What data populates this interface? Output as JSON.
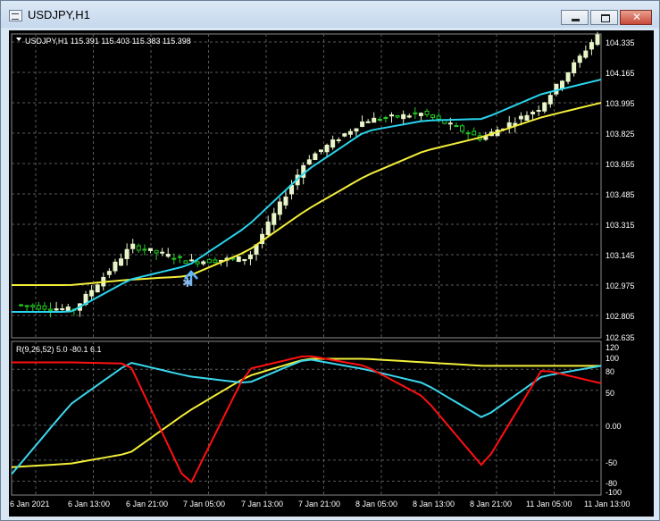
{
  "window": {
    "title": "USDJPY,H1",
    "buttons": {
      "minimize": "minimize",
      "maximize": "maximize",
      "close": "✕"
    }
  },
  "main_chart": {
    "header": "USDJPY,H1  115.391 115.403 115.383 115.398",
    "price_axis": [
      "104.335",
      "104.165",
      "103.995",
      "103.825",
      "103.655",
      "103.485",
      "103.315",
      "103.145",
      "102.975",
      "102.805",
      "102.635"
    ]
  },
  "indicator": {
    "header": "R(9,26,52) 5.0 -80.1 6.1",
    "axis": [
      "120",
      "100",
      "80",
      "50",
      "0.00",
      "-50",
      "-80",
      "-100"
    ]
  },
  "time_axis": [
    "6 Jan 2021",
    "6 Jan 13:00",
    "6 Jan 21:00",
    "7 Jan 05:00",
    "7 Jan 13:00",
    "7 Jan 21:00",
    "8 Jan 05:00",
    "8 Jan 13:00",
    "8 Jan 21:00",
    "11 Jan 05:00",
    "11 Jan 13:00"
  ],
  "colors": {
    "background": "#000000",
    "grid": "#5a5a5a",
    "bull_candle": "#e8f5c8",
    "bear_candle": "#22cc22",
    "ma_fast": "#29d5ee",
    "ma_slow": "#f2ee3a",
    "osc_red": "#ff1010",
    "osc_cyan": "#3ad7ee",
    "osc_yellow": "#f2ee3a",
    "signal_arrow": "#5fb8ff"
  },
  "chart_data": {
    "type": "line",
    "title": "USDJPY,H1",
    "y_range": [
      102.635,
      104.335
    ],
    "x": [
      "6 Jan 2021",
      "6 Jan 13:00",
      "6 Jan 21:00",
      "7 Jan 05:00",
      "7 Jan 13:00",
      "7 Jan 21:00",
      "8 Jan 05:00",
      "8 Jan 13:00",
      "8 Jan 21:00",
      "11 Jan 05:00",
      "11 Jan 13:00"
    ],
    "series": [
      {
        "values": [
          102.82,
          102.79,
          103.15,
          103.06,
          103.08,
          103.63,
          103.85,
          103.89,
          103.75,
          103.92,
          104.33
        ]
      },
      {
        "values": [
          102.78,
          102.78,
          102.96,
          103.04,
          103.26,
          103.57,
          103.79,
          103.85,
          103.86,
          104.0,
          104.08
        ]
      },
      {
        "values": [
          102.93,
          102.93,
          102.96,
          102.98,
          103.12,
          103.35,
          103.54,
          103.68,
          103.76,
          103.87,
          103.95
        ]
      }
    ],
    "indicator": {
      "y_range": [
        -100,
        120
      ],
      "series": [
        {
          "values": [
            90,
            90,
            88,
            -90,
            80,
            100,
            85,
            40,
            -60,
            80,
            60
          ]
        },
        {
          "values": [
            -70,
            30,
            90,
            70,
            60,
            95,
            80,
            60,
            10,
            70,
            85
          ]
        },
        {
          "values": [
            -60,
            -55,
            -40,
            20,
            70,
            95,
            95,
            90,
            85,
            85,
            85
          ]
        }
      ]
    }
  }
}
